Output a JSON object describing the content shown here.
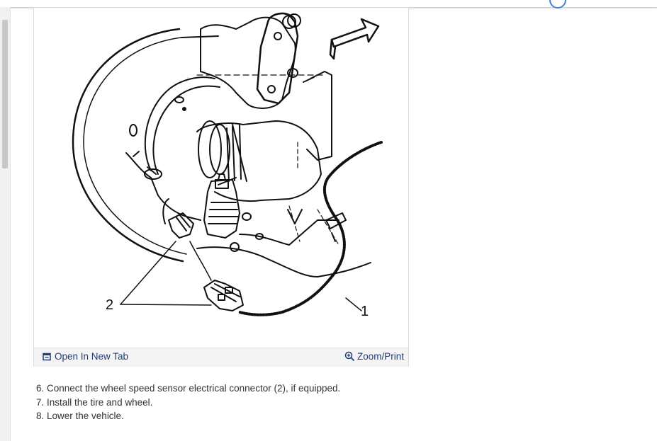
{
  "figure": {
    "callouts": {
      "connector": "2",
      "sensor_wire": "1"
    },
    "footer": {
      "open_label": "Open In New Tab",
      "zoom_label": "Zoom/Print"
    }
  },
  "steps": [
    "6. Connect the wheel speed sensor electrical connector (2), if equipped.",
    "7. Install the tire and wheel.",
    "8. Lower the vehicle."
  ],
  "colors": {
    "link": "#1f3d7a",
    "accent": "#4a7fd6"
  },
  "icons": {
    "open": "open-in-new-tab-icon",
    "zoom": "zoom-in-icon"
  }
}
